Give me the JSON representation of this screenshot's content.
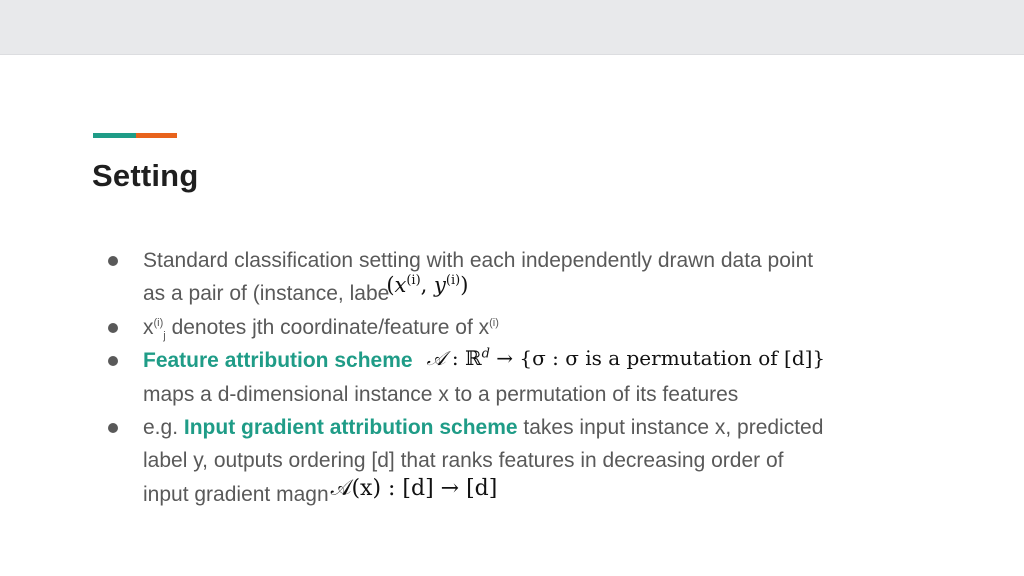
{
  "colors": {
    "accent_teal": "#1f9c87",
    "accent_orange": "#e8631c",
    "text": "#595959",
    "title": "#1f1f1f",
    "top_bar": "#e8e9eb"
  },
  "slide": {
    "title": "Setting",
    "bullets": [
      {
        "line1": "Standard classification setting with each independently drawn data point",
        "line2_text": "as a pair of (instance, labe",
        "math": "(x⁽ⁱ⁾, y⁽ⁱ⁾)",
        "math_parts": {
          "x": "x",
          "y": "y",
          "sup": "(i)"
        }
      },
      {
        "var": "x",
        "sup": "(i)",
        "sub": "j",
        "text": " denotes jth coordinate/feature of x",
        "text_sup": "(i)"
      },
      {
        "highlight": "Feature attribution scheme",
        "math_A": "𝒜",
        "math_rest": " : ℝ",
        "math_sup": "d",
        "math_tail": " → {σ : σ is a permutation of [d]}",
        "line2": "maps a d-dimensional instance x to a permutation of its features"
      },
      {
        "prefix": "e.g. ",
        "highlight": "Input gradient attribution scheme",
        "rest": " takes input instance x, predicted",
        "line2": "label y, outputs ordering [d] that ranks features in decreasing order of",
        "line3_text": "input gradient magn",
        "math": "𝒜(x) : [d] → [d]"
      }
    ]
  }
}
